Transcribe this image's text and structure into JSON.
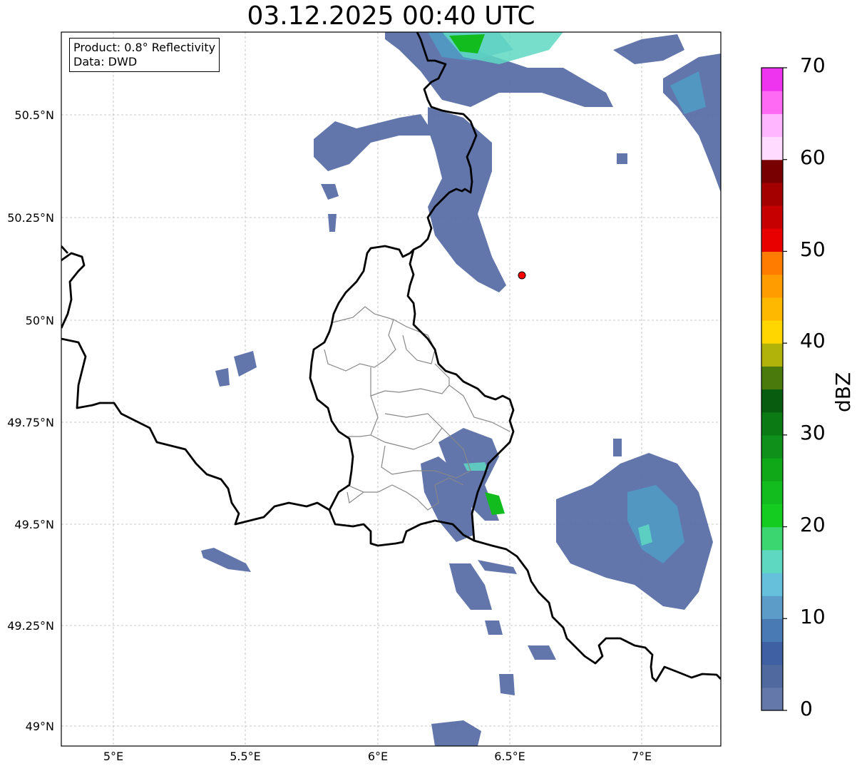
{
  "title": "03.12.2025 00:40 UTC",
  "info_box": {
    "product": "Product: 0.8° Reflectivity",
    "data": "Data: DWD"
  },
  "lat_labels": [
    "50.5°N",
    "50.25°N",
    "50°N",
    "49.75°N",
    "49.5°N",
    "49.25°N",
    "49°N"
  ],
  "lon_labels": [
    "5°E",
    "5.5°E",
    "6°E",
    "6.5°E",
    "7°E"
  ],
  "colorbar": {
    "title": "dBZ",
    "tick_labels": [
      "0",
      "10",
      "20",
      "30",
      "40",
      "50",
      "60",
      "70"
    ],
    "colors": [
      "#6478aa",
      "#50699e",
      "#4060a4",
      "#4a7ab4",
      "#5b9dc8",
      "#66c0dc",
      "#5fd8c2",
      "#3cd670",
      "#14cc20",
      "#12bc1e",
      "#10a818",
      "#0e901a",
      "#0c7a14",
      "#075c10",
      "#4b7a0c",
      "#b1b20a",
      "#ffd600",
      "#ffb800",
      "#ff9c00",
      "#ff7c00",
      "#e80000",
      "#c60000",
      "#a40000",
      "#780000",
      "#ffdcff",
      "#ffb6ff",
      "#ff6af5",
      "#ee34ee"
    ]
  },
  "radar_site_color": "#ff0000",
  "border_color": "#000000",
  "district_color": "#888888"
}
